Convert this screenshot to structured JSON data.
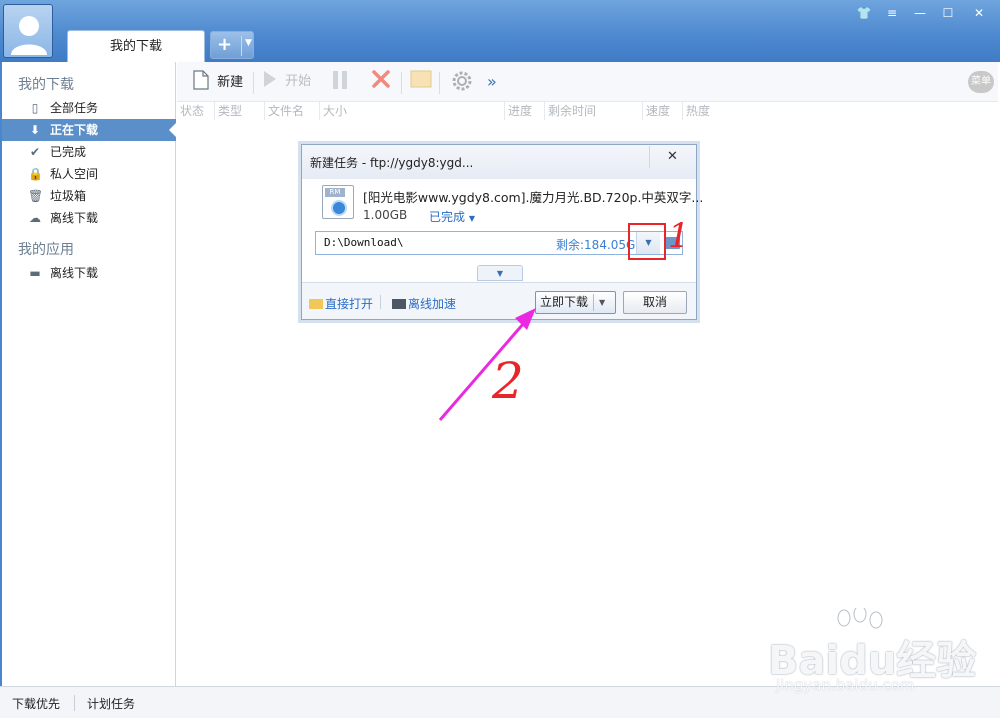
{
  "window": {
    "tab_title": "我的下载",
    "controls": [
      "skin-icon",
      "menu-icon",
      "minimize-icon",
      "maximize-icon",
      "close-icon"
    ]
  },
  "sidebar": {
    "section1": "我的下载",
    "items": [
      {
        "label": "全部任务",
        "icon": "document-icon"
      },
      {
        "label": "正在下载",
        "icon": "download-arrow-icon",
        "active": true
      },
      {
        "label": "已完成",
        "icon": "check-icon"
      },
      {
        "label": "私人空间",
        "icon": "lock-icon"
      },
      {
        "label": "垃圾箱",
        "icon": "trash-icon"
      },
      {
        "label": "离线下载",
        "icon": "cloud-download-icon"
      }
    ],
    "section2": "我的应用",
    "apps": [
      {
        "label": "离线下载",
        "icon": "offline-box-icon"
      }
    ]
  },
  "toolbar": {
    "new_label": "新建",
    "start_label": "开始",
    "more_label": "»",
    "menu_label": "菜单"
  },
  "columns": [
    "状态",
    "类型",
    "文件名",
    "大小",
    "进度",
    "剩余时间",
    "速度",
    "热度"
  ],
  "statusbar": {
    "priority": "下载优先",
    "schedule": "计划任务"
  },
  "dialog": {
    "title": "新建任务 - ftp://ygdy8:ygd...",
    "file_type": "RM",
    "file_name": "[阳光电影www.ygdy8.com].魔力月光.BD.720p.中英双字...",
    "file_size": "1.00GB",
    "file_status": "已完成",
    "path": "D:\\Download\\",
    "free_space": "剩余:184.05GB",
    "open_direct": "直接打开",
    "offline_accel": "离线加速",
    "download_now": "立即下载",
    "cancel": "取消"
  },
  "annotations": {
    "mark1": "1",
    "mark2": "2",
    "color": "#e8262a",
    "arrow_color": "#ea2ae0"
  },
  "watermark": {
    "text": "Baidu经验",
    "url": "jingyan.baidu.com"
  }
}
